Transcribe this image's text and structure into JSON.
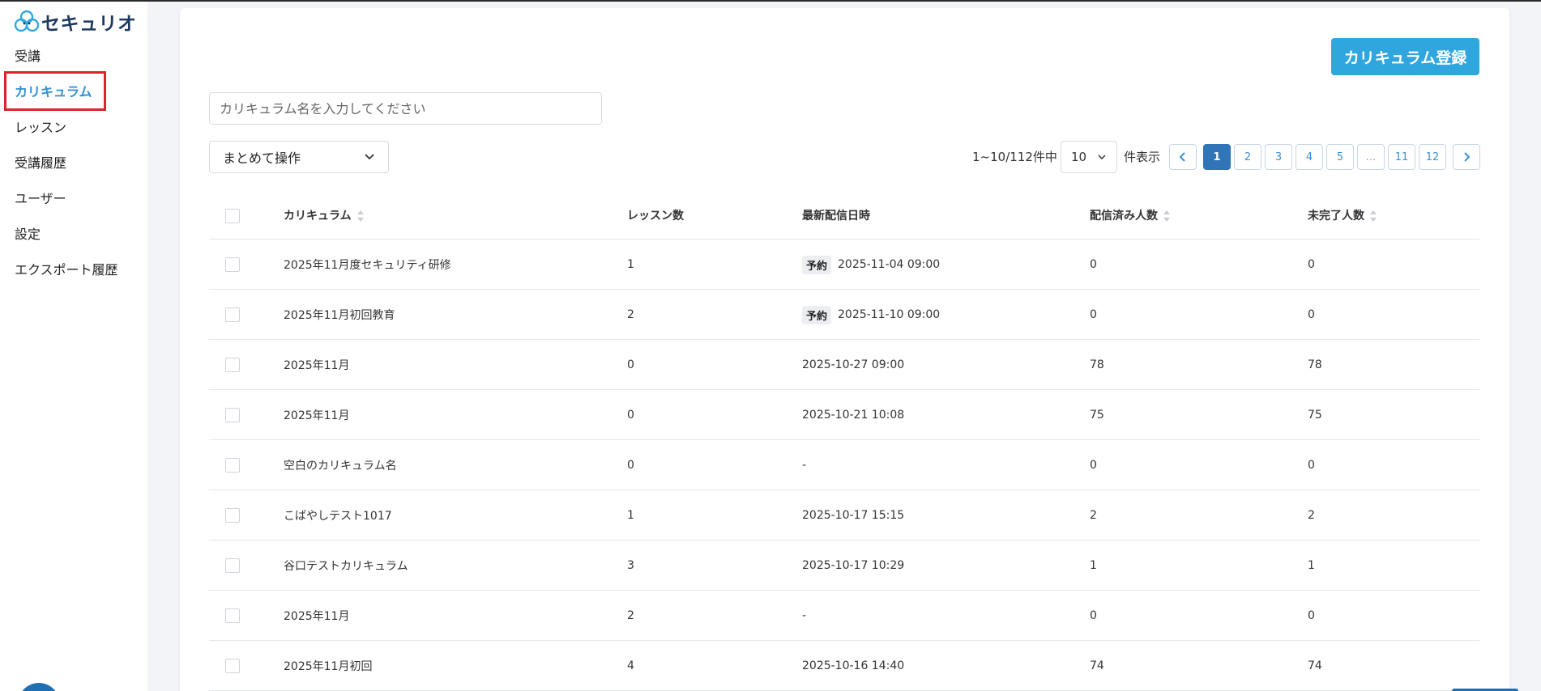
{
  "app": {
    "logo_text": "セキュリオ"
  },
  "sidebar": {
    "items": [
      {
        "label": "受講",
        "active": false
      },
      {
        "label": "カリキュラム",
        "active": true
      },
      {
        "label": "レッスン",
        "active": false
      },
      {
        "label": "受講履歴",
        "active": false
      },
      {
        "label": "ユーザー",
        "active": false
      },
      {
        "label": "設定",
        "active": false
      },
      {
        "label": "エクスポート履歴",
        "active": false
      }
    ]
  },
  "toolbar": {
    "register_label": "カリキュラム登録",
    "search_placeholder": "カリキュラム名を入力してください",
    "search_value": "",
    "bulk_action_label": "まとめて操作",
    "range_text": "1~10/112件中",
    "per_page_value": "10",
    "per_page_suffix": "件表示"
  },
  "pagination": {
    "current": "1",
    "pages": [
      "1",
      "2",
      "3",
      "4",
      "5",
      "...",
      "11",
      "12"
    ]
  },
  "table": {
    "headers": {
      "name": "カリキュラム",
      "lessons": "レッスン数",
      "latest_delivery": "最新配信日時",
      "delivered": "配信済み人数",
      "incomplete": "未完了人数"
    },
    "rows": [
      {
        "name": "2025年11月度セキュリティ研修",
        "lessons": "1",
        "badge": "予約",
        "date": "2025-11-04 09:00",
        "delivered": "0",
        "incomplete": "0"
      },
      {
        "name": "2025年11月初回教育",
        "lessons": "2",
        "badge": "予約",
        "date": "2025-11-10 09:00",
        "delivered": "0",
        "incomplete": "0"
      },
      {
        "name": "2025年11月",
        "lessons": "0",
        "badge": "",
        "date": "2025-10-27 09:00",
        "delivered": "78",
        "incomplete": "78"
      },
      {
        "name": "2025年11月",
        "lessons": "0",
        "badge": "",
        "date": "2025-10-21 10:08",
        "delivered": "75",
        "incomplete": "75"
      },
      {
        "name": "空白のカリキュラム名",
        "lessons": "0",
        "badge": "",
        "date": "-",
        "delivered": "0",
        "incomplete": "0"
      },
      {
        "name": "こばやしテスト1017",
        "lessons": "1",
        "badge": "",
        "date": "2025-10-17 15:15",
        "delivered": "2",
        "incomplete": "2"
      },
      {
        "name": "谷口テストカリキュラム",
        "lessons": "3",
        "badge": "",
        "date": "2025-10-17 10:29",
        "delivered": "1",
        "incomplete": "1"
      },
      {
        "name": "2025年11月",
        "lessons": "2",
        "badge": "",
        "date": "-",
        "delivered": "0",
        "incomplete": "0"
      },
      {
        "name": "2025年11月初回",
        "lessons": "4",
        "badge": "",
        "date": "2025-10-16 14:40",
        "delivered": "74",
        "incomplete": "74"
      }
    ]
  },
  "colors": {
    "accent": "#2fa6de",
    "active_nav": "#2d8fd5",
    "highlight_box": "#d9252b",
    "pager_active": "#2f75b7"
  }
}
